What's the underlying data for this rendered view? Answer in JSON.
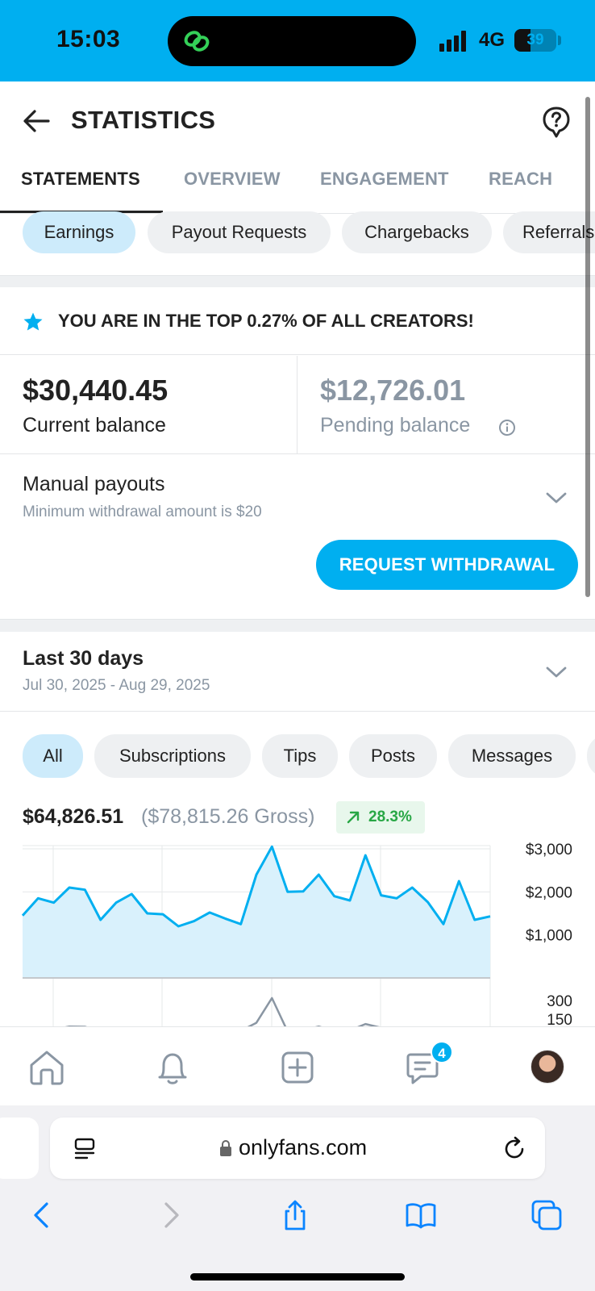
{
  "status_bar": {
    "time": "15:03",
    "network": "4G",
    "battery": "39"
  },
  "header": {
    "title": "STATISTICS"
  },
  "tabs": [
    {
      "label": "STATEMENTS",
      "active": true
    },
    {
      "label": "OVERVIEW",
      "active": false
    },
    {
      "label": "ENGAGEMENT",
      "active": false
    },
    {
      "label": "REACH",
      "active": false
    }
  ],
  "sub_tabs": [
    {
      "label": "Earnings",
      "active": true
    },
    {
      "label": "Payout Requests",
      "active": false
    },
    {
      "label": "Chargebacks",
      "active": false
    },
    {
      "label": "Referrals",
      "active": false
    }
  ],
  "banner": {
    "text": "YOU ARE IN THE TOP 0.27% OF ALL CREATORS!"
  },
  "balances": {
    "current": {
      "amount": "$30,440.45",
      "label": "Current balance"
    },
    "pending": {
      "amount": "$12,726.01",
      "label": "Pending balance"
    }
  },
  "payouts": {
    "title": "Manual payouts",
    "subtitle": "Minimum withdrawal amount is $20",
    "button": "REQUEST WITHDRAWAL"
  },
  "period": {
    "title": "Last 30 days",
    "range": "Jul 30, 2025 - Aug 29, 2025"
  },
  "filters": [
    {
      "label": "All",
      "active": true
    },
    {
      "label": "Subscriptions",
      "active": false
    },
    {
      "label": "Tips",
      "active": false
    },
    {
      "label": "Posts",
      "active": false
    },
    {
      "label": "Messages",
      "active": false
    }
  ],
  "totals": {
    "net": "$64,826.51",
    "gross": "($78,815.26 Gross)",
    "growth": "28.3%"
  },
  "chart_data": {
    "type": "area",
    "title": "",
    "xlabel": "",
    "ylabel": "",
    "ylim": [
      0,
      3000
    ],
    "y_ticks": [
      "$3,000",
      "$2,000",
      "$1,000"
    ],
    "y_tick_values": [
      3000,
      2000,
      1000
    ],
    "series": [
      {
        "values": [
          1450,
          1850,
          1750,
          2100,
          2050,
          1350,
          1750,
          1950,
          1500,
          1480,
          1200,
          1320,
          1520,
          1380,
          1250,
          2400,
          3050,
          2000,
          2010,
          2400,
          1900,
          1800,
          2850,
          1920,
          1850,
          2100,
          1760,
          1250,
          2250,
          1350,
          1430
        ]
      }
    ],
    "secondary": {
      "y_ticks": [
        "300",
        "150"
      ],
      "y_tick_values": [
        300,
        150
      ],
      "values": [
        60,
        75,
        65,
        90,
        88,
        50,
        70,
        60,
        55,
        62,
        55,
        50,
        52,
        48,
        55,
        120,
        320,
        50,
        60,
        90,
        55,
        58,
        110,
        80,
        58,
        82,
        60,
        45,
        70,
        45,
        50
      ]
    }
  },
  "bottom_nav": {
    "messages_badge": "4"
  },
  "browser": {
    "url": "onlyfans.com"
  },
  "colors": {
    "accent": "#00aff0",
    "positive": "#28a745",
    "muted": "#8a96a3"
  }
}
